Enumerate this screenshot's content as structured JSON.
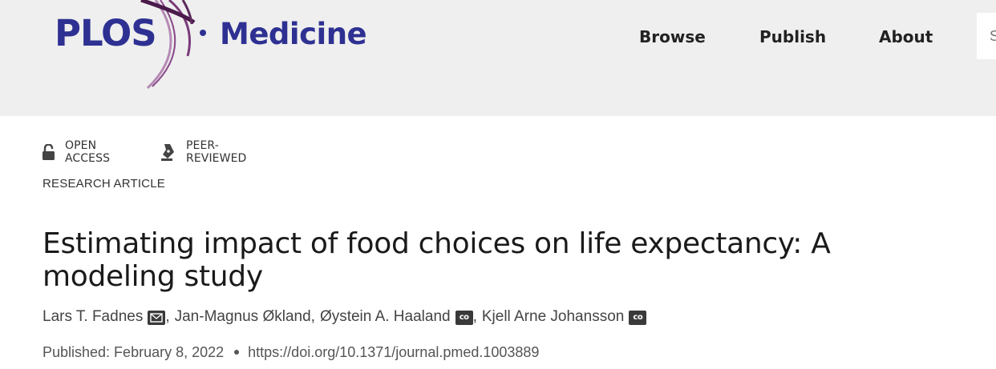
{
  "header": {
    "logo": {
      "brand": "PLOS",
      "journal": "Medicine"
    },
    "nav": {
      "browse": "Browse",
      "publish": "Publish",
      "about": "About"
    },
    "search": {
      "placeholder": "S"
    },
    "colors": {
      "brand": "#2e3192",
      "accent": "#6b2d6b",
      "background": "#efefef"
    }
  },
  "article": {
    "badges": {
      "open_access": {
        "label": "OPEN ACCESS",
        "icon": "unlocked-padlock-icon"
      },
      "peer_reviewed": {
        "label": "PEER-REVIEWED",
        "icon": "pen-nib-icon"
      }
    },
    "type": "RESEARCH ARTICLE",
    "title": "Estimating impact of food choices on life expectancy: A modeling study",
    "authors": [
      {
        "name": "Lars T. Fadnes",
        "icon": "email-icon"
      },
      {
        "name": "Jan-Magnus Økland"
      },
      {
        "name": "Øystein A. Haaland",
        "icon": "co-icon",
        "icon_text": "co"
      },
      {
        "name": "Kjell Arne Johansson",
        "icon": "co-icon",
        "icon_text": "co"
      }
    ],
    "published": "Published: February 8, 2022",
    "doi": "https://doi.org/10.1371/journal.pmed.1003889"
  }
}
